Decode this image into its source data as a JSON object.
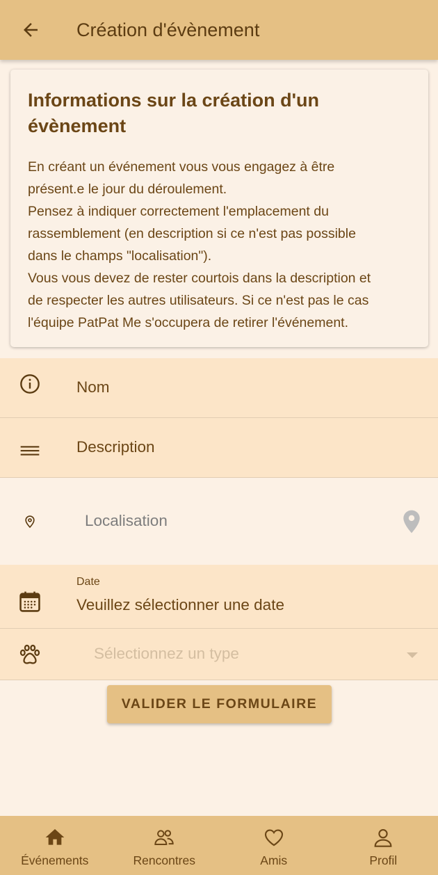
{
  "appbar": {
    "title": "Création d'évènement",
    "back_icon": "arrow-left-icon"
  },
  "info_card": {
    "title": "Informations sur la création d'un évènement",
    "lines": [
      "En créant un événement vous vous engagez à être",
      "présent.e le jour du déroulement.",
      "Pensez à indiquer correctement l'emplacement du",
      "rassemblement (en description si ce n'est pas possible",
      "dans le champs \"localisation\").",
      "Vous vous devez de rester courtois dans la description et",
      "de respecter les autres utilisateurs. Si ce n'est pas le cas",
      "l'équipe PatPat Me s'occupera de retirer l'événement."
    ]
  },
  "form": {
    "name": {
      "label": "Nom",
      "icon": "info-circle-icon"
    },
    "description": {
      "label": "Description",
      "icon": "menu-lines-icon"
    },
    "location": {
      "placeholder": "Localisation",
      "icon": "map-pin-icon",
      "trailing_icon": "location-marker-icon"
    },
    "date": {
      "label": "Date",
      "value": "Veuillez sélectionner une date",
      "icon": "calendar-icon"
    },
    "type": {
      "placeholder": "Sélectionnez un type",
      "icon": "paw-icon",
      "trailing_icon": "dropdown-arrow-icon"
    }
  },
  "submit_label": "VALIDER LE FORMULAIRE",
  "bottom_nav": {
    "items": [
      {
        "label": "Événements",
        "icon": "home-icon"
      },
      {
        "label": "Rencontres",
        "icon": "people-icon"
      },
      {
        "label": "Amis",
        "icon": "heart-icon"
      },
      {
        "label": "Profil",
        "icon": "user-icon"
      }
    ]
  },
  "colors": {
    "appbar": "#e5c084",
    "background": "#fcf1e5",
    "field": "#fce5c8",
    "text": "#6b4616"
  }
}
